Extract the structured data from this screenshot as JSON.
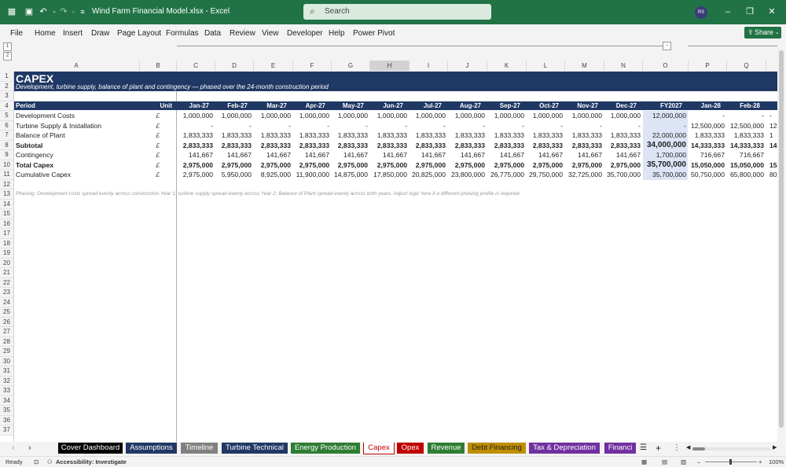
{
  "titlebar": {
    "doc_title": "Wind Farm Financial Model.xlsx  -  Excel",
    "search_placeholder": "Search",
    "avatar_initials": "RS",
    "bg_color": "#217346"
  },
  "ribbon": {
    "tabs": [
      "File",
      "Home",
      "Insert",
      "Draw",
      "Page Layout",
      "Formulas",
      "Data",
      "Review",
      "View",
      "Developer",
      "Help",
      "Power Pivot"
    ],
    "share_label": "Share"
  },
  "columns": [
    "A",
    "B",
    "C",
    "D",
    "E",
    "F",
    "G",
    "H",
    "I",
    "J",
    "K",
    "L",
    "M",
    "N",
    "O",
    "P",
    "Q"
  ],
  "selected_column": "H",
  "row_numbers": [
    "1",
    "2",
    "3",
    "4",
    "5",
    "6",
    "7",
    "8",
    "9",
    "10",
    "11",
    "12",
    "13",
    "14",
    "15",
    "16",
    "17",
    "18",
    "19",
    "20",
    "21",
    "22",
    "23",
    "24",
    "25",
    "26",
    "27",
    "28",
    "29",
    "30",
    "31",
    "32",
    "33",
    "34",
    "35",
    "36",
    "37"
  ],
  "sheet": {
    "title": "CAPEX",
    "subtitle": "Development, turbine supply, balance of plant and contingency — phased over the 24-month construction period",
    "header": {
      "period": "Period",
      "unit": "Unit",
      "months": [
        "Jan-27",
        "Feb-27",
        "Mar-27",
        "Apr-27",
        "May-27",
        "Jun-27",
        "Jul-27",
        "Aug-27",
        "Sep-27",
        "Oct-27",
        "Nov-27",
        "Dec-27",
        "FY2027",
        "Jan-28",
        "Feb-28"
      ]
    },
    "rows": [
      {
        "label": "Development Costs",
        "unit": "£",
        "bold": false,
        "values": [
          "1,000,000",
          "1,000,000",
          "1,000,000",
          "1,000,000",
          "1,000,000",
          "1,000,000",
          "1,000,000",
          "1,000,000",
          "1,000,000",
          "1,000,000",
          "1,000,000",
          "1,000,000",
          "12,000,000",
          "-",
          "-"
        ],
        "overflow": "-"
      },
      {
        "label": "Turbine Supply & Installation",
        "unit": "£",
        "bold": false,
        "values": [
          "-",
          "-",
          "-",
          "-",
          "-",
          "-",
          "-",
          "-",
          "-",
          "-",
          "-",
          "-",
          "-",
          "12,500,000",
          "12,500,000"
        ],
        "overflow": "12"
      },
      {
        "label": "Balance of Plant",
        "unit": "£",
        "bold": false,
        "values": [
          "1,833,333",
          "1,833,333",
          "1,833,333",
          "1,833,333",
          "1,833,333",
          "1,833,333",
          "1,833,333",
          "1,833,333",
          "1,833,333",
          "1,833,333",
          "1,833,333",
          "1,833,333",
          "22,000,000",
          "1,833,333",
          "1,833,333"
        ],
        "overflow": "1"
      },
      {
        "label": "Subtotal",
        "unit": "£",
        "bold": true,
        "values": [
          "2,833,333",
          "2,833,333",
          "2,833,333",
          "2,833,333",
          "2,833,333",
          "2,833,333",
          "2,833,333",
          "2,833,333",
          "2,833,333",
          "2,833,333",
          "2,833,333",
          "2,833,333",
          "34,000,000",
          "14,333,333",
          "14,333,333"
        ],
        "overflow": "14"
      },
      {
        "label": "Contingency",
        "unit": "£",
        "bold": false,
        "values": [
          "141,667",
          "141,667",
          "141,667",
          "141,667",
          "141,667",
          "141,667",
          "141,667",
          "141,667",
          "141,667",
          "141,667",
          "141,667",
          "141,667",
          "1,700,000",
          "716,667",
          "716,667"
        ],
        "overflow": ""
      },
      {
        "label": "Total Capex",
        "unit": "£",
        "bold": true,
        "values": [
          "2,975,000",
          "2,975,000",
          "2,975,000",
          "2,975,000",
          "2,975,000",
          "2,975,000",
          "2,975,000",
          "2,975,000",
          "2,975,000",
          "2,975,000",
          "2,975,000",
          "2,975,000",
          "35,700,000",
          "15,050,000",
          "15,050,000"
        ],
        "overflow": "15"
      },
      {
        "label": "Cumulative Capex",
        "unit": "£",
        "bold": false,
        "values": [
          "2,975,000",
          "5,950,000",
          "8,925,000",
          "11,900,000",
          "14,875,000",
          "17,850,000",
          "20,825,000",
          "23,800,000",
          "26,775,000",
          "29,750,000",
          "32,725,000",
          "35,700,000",
          "35,700,000",
          "50,750,000",
          "65,800,000"
        ],
        "overflow": "80"
      }
    ],
    "note": "Phasing: Development costs spread evenly across construction Year 1; turbine supply spread evenly across Year 2; Balance of Plant spread evenly across both years. Adjust logic here if a different phasing profile is required.",
    "title_bg": "#203864",
    "fy_col_bg": "#dce4f5"
  },
  "sheet_tabs": [
    {
      "label": "Cover Dashboard",
      "bg": "#000000",
      "fg": "#ffffff"
    },
    {
      "label": "Assumptions",
      "bg": "#203864",
      "fg": "#ffffff"
    },
    {
      "label": "Timeline",
      "bg": "#808080",
      "fg": "#ffffff"
    },
    {
      "label": "Turbine Technical",
      "bg": "#203864",
      "fg": "#ffffff"
    },
    {
      "label": "Energy Production",
      "bg": "#2e7d32",
      "fg": "#ffffff"
    },
    {
      "label": "Capex",
      "bg": "#ffffff",
      "fg": "#c00000"
    },
    {
      "label": "Opex",
      "bg": "#c00000",
      "fg": "#ffffff"
    },
    {
      "label": "Revenue",
      "bg": "#2e7d32",
      "fg": "#ffffff"
    },
    {
      "label": "Debt Financing",
      "bg": "#bf8f00",
      "fg": "#222222"
    },
    {
      "label": "Tax & Depreciation",
      "bg": "#7030a0",
      "fg": "#ffffff"
    },
    {
      "label": "Financi",
      "bg": "#7030a0",
      "fg": "#ffffff"
    }
  ],
  "status": {
    "ready": "Ready",
    "accessibility": "Accessibility: Investigate",
    "zoom": "100%"
  }
}
